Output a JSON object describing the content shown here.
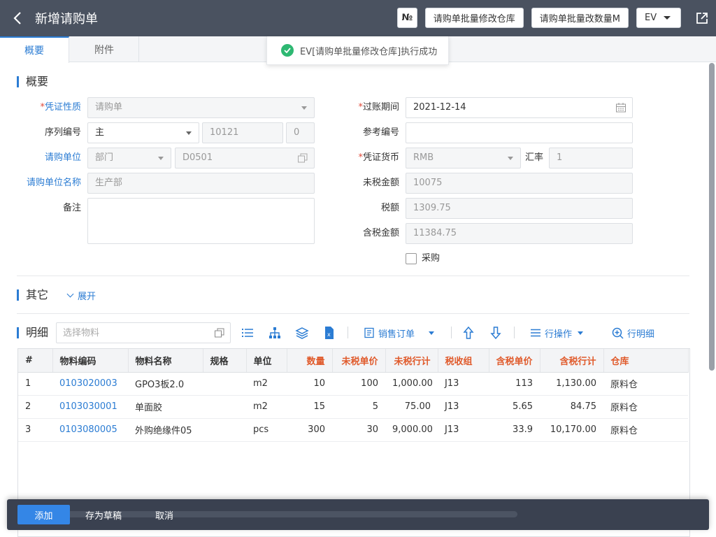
{
  "header": {
    "title": "新增请购单",
    "no_label": "№",
    "btn_batch_warehouse": "请购单批量修改仓库",
    "btn_batch_qty": "请购单批量改数量M",
    "ev_label": "EV"
  },
  "tabs": [
    {
      "label": "概要"
    },
    {
      "label": "附件"
    }
  ],
  "toast": {
    "message": "EV[请购单批量修改仓库]执行成功"
  },
  "summary": {
    "title": "概要",
    "voucher_type": {
      "label": "凭证性质",
      "value": "请购单"
    },
    "serial_no": {
      "label": "序列编号",
      "value": "主",
      "number": "10121",
      "suffix": "0"
    },
    "request_unit": {
      "label": "请购单位",
      "type": "部门",
      "code": "D0501"
    },
    "request_unit_name": {
      "label": "请购单位名称",
      "value": "生产部"
    },
    "remark": {
      "label": "备注",
      "value": ""
    },
    "posting_period": {
      "label": "过账期间",
      "value": "2021-12-14"
    },
    "reference_no": {
      "label": "参考编号",
      "value": ""
    },
    "currency": {
      "label": "凭证货币",
      "value": "RMB",
      "rate_label": "汇率",
      "rate": "1"
    },
    "amount_excl_tax": {
      "label": "未税金额",
      "value": "10075"
    },
    "tax": {
      "label": "税额",
      "value": "1309.75"
    },
    "amount_incl_tax": {
      "label": "含税金额",
      "value": "11384.75"
    },
    "purchase": {
      "label": "采购",
      "checked": false
    }
  },
  "other": {
    "title": "其它",
    "expand_label": "展开"
  },
  "detail": {
    "title": "明细",
    "search_placeholder": "选择物料",
    "sales_order_label": "销售订单",
    "row_ops_label": "行操作",
    "row_detail_label": "行明细",
    "columns": [
      "#",
      "物料编码",
      "物料名称",
      "规格",
      "单位",
      "数量",
      "未税单价",
      "未税行计",
      "税收组",
      "含税单价",
      "含税行计",
      "仓库"
    ],
    "rows": [
      {
        "idx": "1",
        "code": "0103020003",
        "name": "GPO3板2.0",
        "spec": "",
        "unit": "m2",
        "qty": "10",
        "price": "100",
        "line_total": "1,000.00",
        "tax_group": "J13",
        "price_tax": "113",
        "line_total_tax": "1,130.00",
        "warehouse": "原料仓"
      },
      {
        "idx": "2",
        "code": "0103030001",
        "name": "单面胶",
        "spec": "",
        "unit": "m2",
        "qty": "15",
        "price": "5",
        "line_total": "75.00",
        "tax_group": "J13",
        "price_tax": "5.65",
        "line_total_tax": "84.75",
        "warehouse": "原料仓"
      },
      {
        "idx": "3",
        "code": "0103080005",
        "name": "外购绝缘件05",
        "spec": "",
        "unit": "pcs",
        "qty": "300",
        "price": "30",
        "line_total": "9,000.00",
        "tax_group": "J13",
        "price_tax": "33.9",
        "line_total_tax": "10,170.00",
        "warehouse": "原料仓"
      }
    ]
  },
  "footer": {
    "add_label": "添加",
    "draft_label": "存为草稿",
    "cancel_label": "取消"
  },
  "colors": {
    "topbar": "#4a5260",
    "accent": "#2b7cd3",
    "required": "#e04a3a",
    "header_red": "#e05a2b",
    "success": "#2eb872",
    "bottombar": "#3a4150"
  }
}
